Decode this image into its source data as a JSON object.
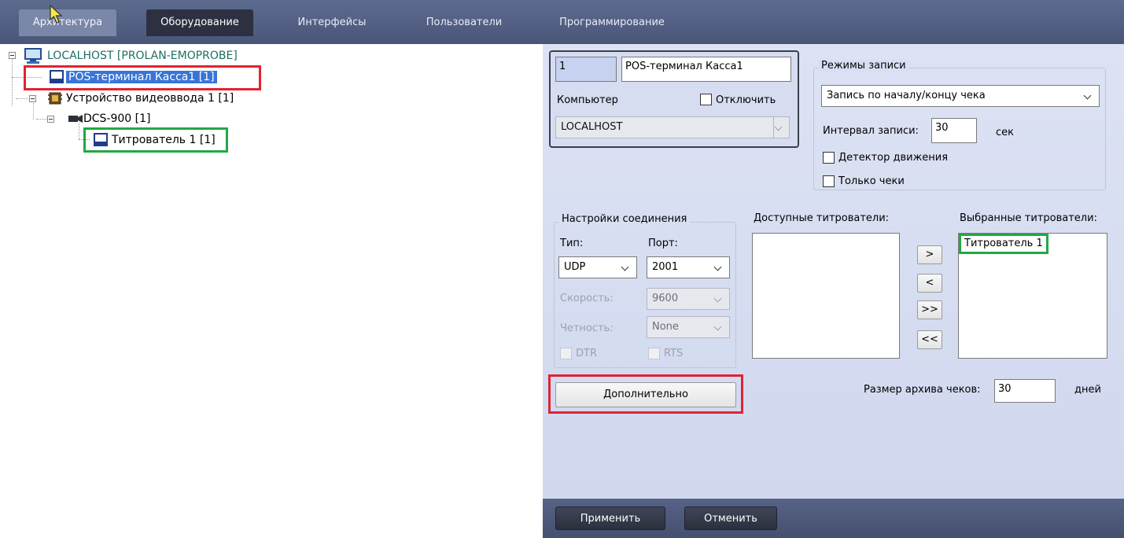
{
  "tabs": {
    "architecture": "Архитектура",
    "equipment": "Оборудование",
    "interfaces": "Интерфейсы",
    "users": "Пользователи",
    "programming": "Программирование"
  },
  "tree": {
    "root": "LOCALHOST [PROLAN-EMOPROBE]",
    "pos_terminal": "POS-терминал Касса1 [1]",
    "video_device": "Устройство видеоввода 1 [1]",
    "camera": "DCS-900 [1]",
    "titler": "Титрователь 1 [1]"
  },
  "form": {
    "id_value": "1",
    "name_value": "POS-терминал Касса1",
    "computer_label": "Компьютер",
    "disable_label": "Отключить",
    "computer_value": "LOCALHOST",
    "record_modes_title": "Режимы записи",
    "record_mode_value": "Запись по началу/концу чека",
    "interval_label": "Интервал записи:",
    "interval_value": "30",
    "interval_unit": "сек",
    "motion_label": "Детектор движения",
    "checks_only_label": "Только чеки",
    "conn_title": "Настройки соединения",
    "type_label": "Тип:",
    "port_label": "Порт:",
    "type_value": "UDP",
    "port_value": "2001",
    "speed_label": "Скорость:",
    "speed_value": "9600",
    "parity_label": "Четность:",
    "parity_value": "None",
    "dtr_label": "DTR",
    "rts_label": "RTS",
    "available_title": "Доступные титрователи:",
    "selected_title": "Выбранные титрователи:",
    "selected_items": [
      "Титрователь 1"
    ],
    "btn_add": ">",
    "btn_remove": "<",
    "btn_add_all": ">>",
    "btn_remove_all": "<<",
    "advanced_label": "Дополнительно",
    "archive_label": "Размер архива чеков:",
    "archive_value": "30",
    "archive_unit": "дней"
  },
  "footer": {
    "apply": "Применить",
    "cancel": "Отменить"
  },
  "colors": {
    "selection": "#3875d7",
    "highlight_red": "#e0242f",
    "highlight_green": "#22a845"
  }
}
